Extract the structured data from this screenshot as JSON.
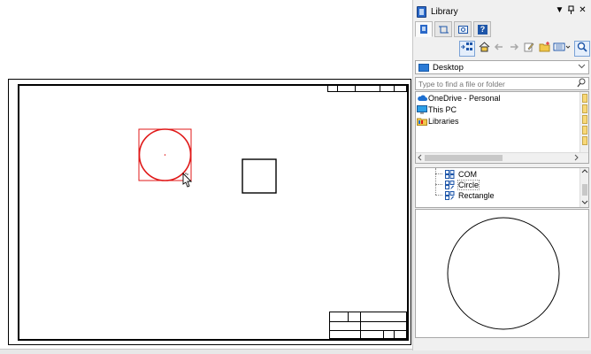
{
  "library": {
    "title": "Library",
    "controls": {
      "dropdown": "▼",
      "pin": "📌",
      "close": "✕"
    },
    "tabs": [
      {
        "icon": "library-icon"
      },
      {
        "icon": "symbol-icon"
      },
      {
        "icon": "gallery-icon"
      },
      {
        "icon": "help-icon",
        "glyph": "?"
      }
    ],
    "toolbar": [
      "insert-block-icon",
      "home-icon",
      "back-icon",
      "forward-icon",
      "edit-icon",
      "new-folder-icon",
      "view-options-icon",
      "search-icon"
    ],
    "location": {
      "value": "Desktop"
    },
    "search": {
      "placeholder": "Type to find a file or folder"
    },
    "files": [
      {
        "label": "OneDrive - Personal",
        "icon": "cloud-icon"
      },
      {
        "label": "This PC",
        "icon": "computer-icon"
      },
      {
        "label": "Libraries",
        "icon": "libraries-folder-icon"
      }
    ],
    "tree": [
      {
        "label": "COM",
        "icon": "block-icon"
      },
      {
        "label": "Circle",
        "icon": "block-icon"
      },
      {
        "label": "Rectangle",
        "icon": "block-icon"
      }
    ]
  },
  "colors": {
    "selection": "#e01818",
    "accent": "#2a68c8",
    "panel_bg": "#f0f0f0"
  }
}
